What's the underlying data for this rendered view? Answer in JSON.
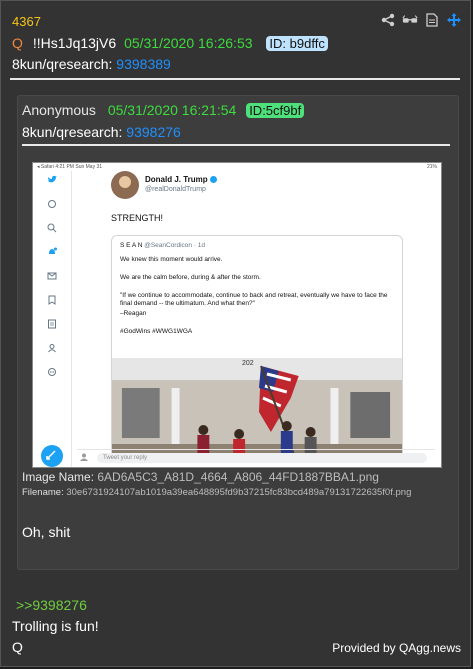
{
  "post": {
    "number": "4367",
    "q_label": "Q",
    "tripcode": "!!Hs1Jq13jV6",
    "date": "05/31/2020 16:26:53",
    "id_badge": "ID: b9dffc",
    "board_prefix": "8kun/qresearch:",
    "board_post": "9398389"
  },
  "toolbar": {
    "icons": [
      "share-icon",
      "glasses-icon",
      "document-icon",
      "move-icon"
    ]
  },
  "quoted": {
    "author": "Anonymous",
    "date": "05/31/2020 16:21:54",
    "id_badge": "ID:5cf9bf",
    "board_prefix": "8kun/qresearch:",
    "board_post": "9398276",
    "image_name_label": "Image Name:",
    "image_name": "6AD6A5C3_A81D_4664_A806_44FD1887BBA1.png",
    "filename_label": "Filename:",
    "filename": "30e6731924107ab1019a39ea648895fd9b37215fc83bcd489a79131722635f0f.png",
    "text": "Oh, shit",
    "screenshot": {
      "status_left": "◂ Safari  4:21 PM  Sun May 31",
      "status_right": "21%",
      "author_name": "Donald J. Trump",
      "author_handle": "@realDonaldTrump",
      "tweet_text": "STRENGTH!",
      "inner_author": "S E A N",
      "inner_handle": "@SeanCordicon · 1d",
      "inner_lines": [
        "We knew this moment would arrive.",
        "We are the calm before, during & after the storm.",
        "\"If we continue to accommodate, continue to back and retreat, eventually we have to face the final demand -- the ultimatum. And what then?\"",
        "–Reagan",
        "#GodWins #WWG1WGA"
      ],
      "house_number": "202",
      "reply_placeholder": "Tweet your reply"
    }
  },
  "reply_ref": ">>9398276",
  "message_lines": [
    "Trolling is fun!",
    "Q"
  ],
  "footer": "Provided by QAgg.news",
  "colors": {
    "post_number": "#f5c518",
    "date": "#3ddc3d",
    "link": "#1e90ff",
    "reply_ref": "#6fce3f",
    "q_label": "#f0873a"
  }
}
